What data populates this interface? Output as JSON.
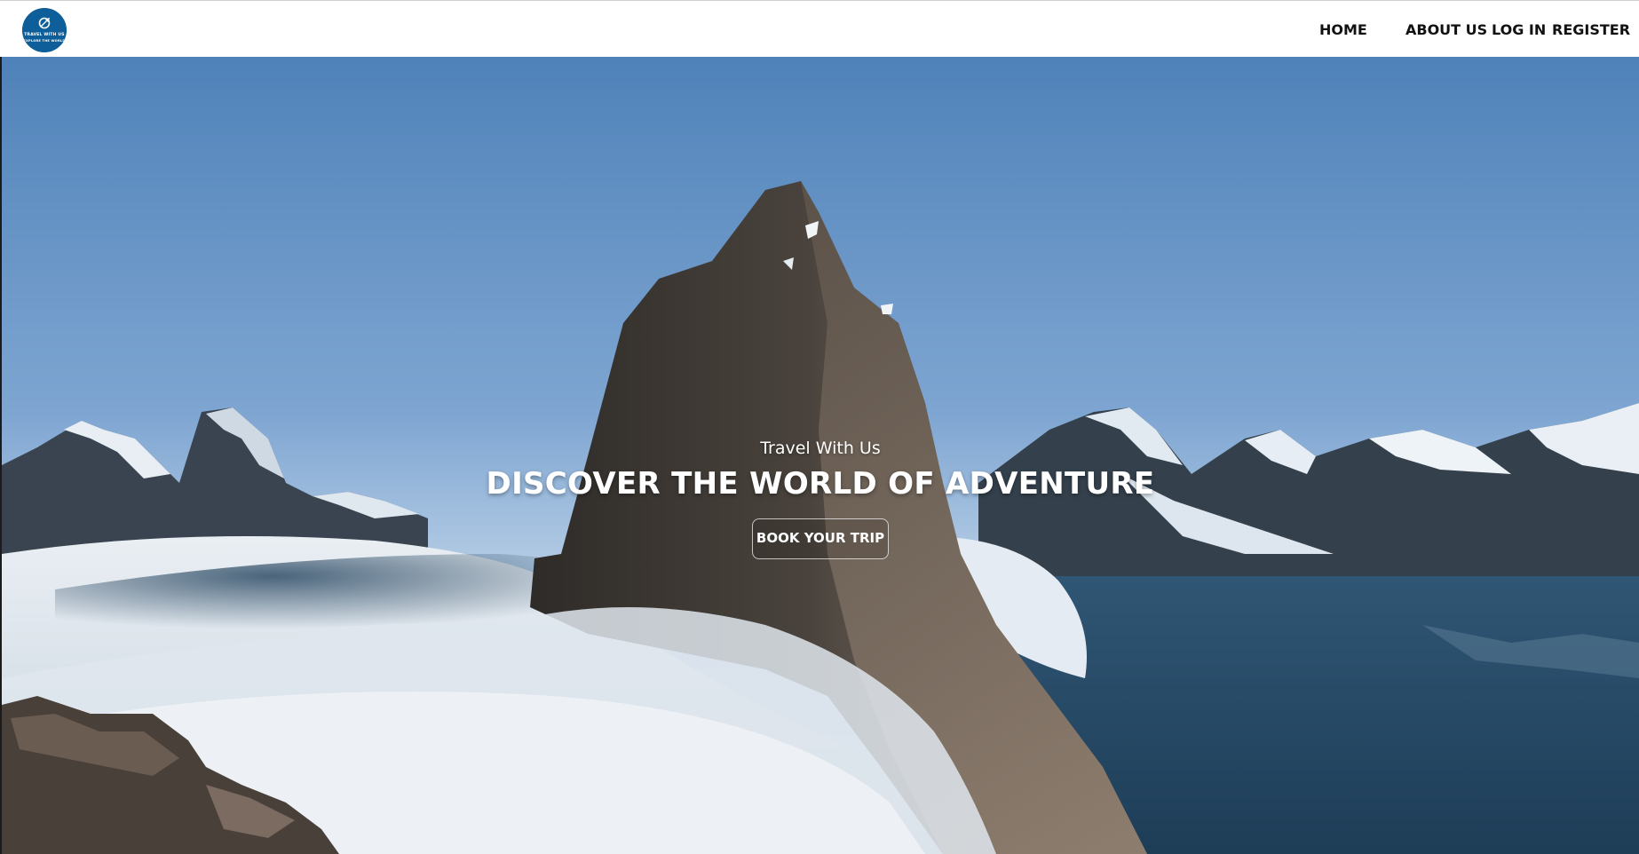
{
  "header": {
    "logo": {
      "icon": "travel-logo-icon",
      "line1": "TRAVEL WITH US",
      "line2": "EXPLORE THE WORLD",
      "color": "#0e5f99"
    },
    "nav": [
      {
        "label": "HOME"
      },
      {
        "label": "ABOUT US"
      },
      {
        "label": "LOG IN"
      },
      {
        "label": "REGISTER"
      }
    ]
  },
  "hero": {
    "subtitle": "Travel With Us",
    "headline": "DISCOVER THE WORLD OF ADVENTURE",
    "cta_label": "BOOK YOUR TRIP"
  }
}
